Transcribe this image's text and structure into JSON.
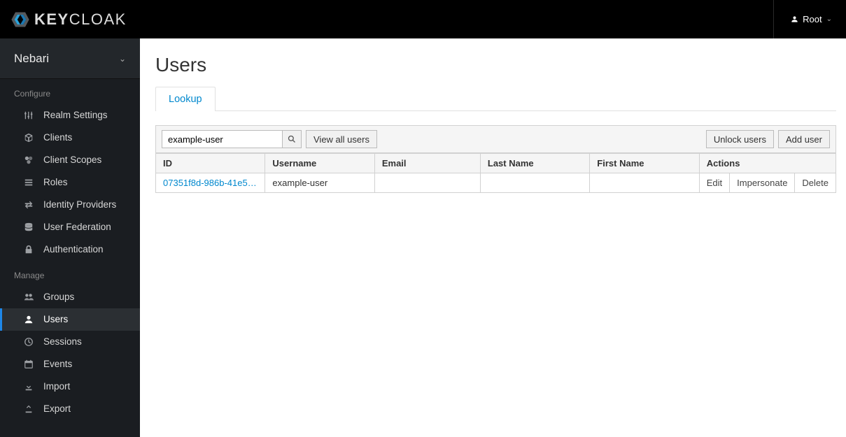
{
  "header": {
    "brand_word1": "KEY",
    "brand_word2": "CLOAK",
    "user_label": "Root"
  },
  "sidebar": {
    "realm": "Nebari",
    "section_configure": "Configure",
    "section_manage": "Manage",
    "configure": [
      {
        "label": "Realm Settings",
        "icon": "sliders-icon"
      },
      {
        "label": "Clients",
        "icon": "cube-icon"
      },
      {
        "label": "Client Scopes",
        "icon": "scopes-icon"
      },
      {
        "label": "Roles",
        "icon": "list-icon"
      },
      {
        "label": "Identity Providers",
        "icon": "exchange-icon"
      },
      {
        "label": "User Federation",
        "icon": "database-icon"
      },
      {
        "label": "Authentication",
        "icon": "lock-icon"
      }
    ],
    "manage": [
      {
        "label": "Groups",
        "icon": "users-icon"
      },
      {
        "label": "Users",
        "icon": "user-icon",
        "active": true
      },
      {
        "label": "Sessions",
        "icon": "clock-icon"
      },
      {
        "label": "Events",
        "icon": "calendar-icon"
      },
      {
        "label": "Import",
        "icon": "import-icon"
      },
      {
        "label": "Export",
        "icon": "export-icon"
      }
    ]
  },
  "main": {
    "title": "Users",
    "tab_lookup": "Lookup",
    "search_value": "example-user",
    "view_all": "View all users",
    "unlock": "Unlock users",
    "add_user": "Add user",
    "columns": {
      "id": "ID",
      "username": "Username",
      "email": "Email",
      "lastname": "Last Name",
      "firstname": "First Name",
      "actions": "Actions"
    },
    "actions": {
      "edit": "Edit",
      "impersonate": "Impersonate",
      "delete": "Delete"
    },
    "rows": [
      {
        "id": "07351f8d-986b-41e5…",
        "username": "example-user",
        "email": "",
        "lastname": "",
        "firstname": ""
      }
    ]
  }
}
